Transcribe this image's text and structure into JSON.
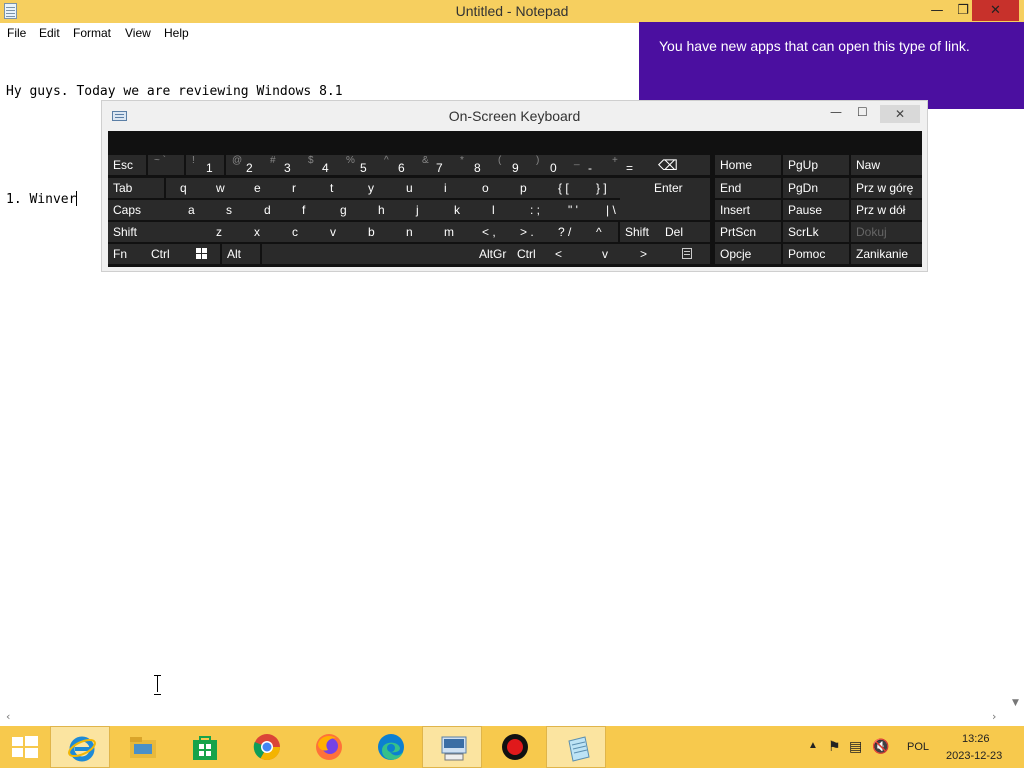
{
  "window": {
    "title": "Untitled - Notepad",
    "min_glyph": "—",
    "max_glyph": "❐",
    "close_glyph": "✕"
  },
  "menu": [
    "File",
    "Edit",
    "Format",
    "View",
    "Help"
  ],
  "editor": {
    "lines": [
      "Hy guys. Today we are reviewing Windows 8.1",
      "",
      "1. Winver"
    ]
  },
  "toast": {
    "message": "You have new apps that can open this type of link."
  },
  "osk": {
    "title": "On-Screen Keyboard",
    "min_glyph": "—",
    "max_glyph": "☐",
    "close_glyph": "✕",
    "row1": [
      {
        "label": "Esc"
      },
      {
        "sub": "~ `",
        "main": ""
      },
      {
        "sub": "!",
        "main": "1"
      },
      {
        "sub": "@",
        "main": "2"
      },
      {
        "sub": "#",
        "main": "3"
      },
      {
        "sub": "$",
        "main": "4"
      },
      {
        "sub": "%",
        "main": "5"
      },
      {
        "sub": "^",
        "main": "6"
      },
      {
        "sub": "&",
        "main": "7"
      },
      {
        "sub": "*",
        "main": "8"
      },
      {
        "sub": "(",
        "main": "9"
      },
      {
        "sub": ")",
        "main": "0"
      },
      {
        "sub": "_",
        "main": "-"
      },
      {
        "sub": "+",
        "main": "="
      },
      {
        "label": "⌫"
      }
    ],
    "row2": [
      "Tab",
      "q",
      "w",
      "e",
      "r",
      "t",
      "y",
      "u",
      "i",
      "o",
      "p",
      "{ [",
      "} ]",
      "Enter"
    ],
    "row3": [
      "Caps",
      "a",
      "s",
      "d",
      "f",
      "g",
      "h",
      "j",
      "k",
      "l",
      ": ;",
      "\" '",
      "| \\"
    ],
    "row4": [
      "Shift",
      "z",
      "x",
      "c",
      "v",
      "b",
      "n",
      "m",
      "< ,",
      "> .",
      "? /",
      "^",
      "Shift",
      "Del"
    ],
    "row5": [
      "Fn",
      "Ctrl",
      "",
      "Alt",
      "",
      "AltGr",
      "Ctrl",
      "<",
      "v",
      ">",
      ""
    ],
    "nav": [
      [
        "Home",
        "PgUp",
        "Naw"
      ],
      [
        "End",
        "PgDn",
        "Prz w górę"
      ],
      [
        "Insert",
        "Pause",
        "Prz w dół"
      ],
      [
        "PrtScn",
        "ScrLk",
        "Dokuj"
      ],
      [
        "Opcje",
        "Pomoc",
        "Zanikanie"
      ]
    ]
  },
  "taskbar": {
    "apps": [
      "start-icon",
      "internet-explorer-icon",
      "file-explorer-icon",
      "store-icon",
      "chrome-icon",
      "firefox-icon",
      "edge-icon",
      "on-screen-keyboard-icon",
      "recorder-icon",
      "notepad-icon"
    ],
    "tray": {
      "language": "POL",
      "time": "13:26",
      "date": "2023-12-23"
    }
  }
}
